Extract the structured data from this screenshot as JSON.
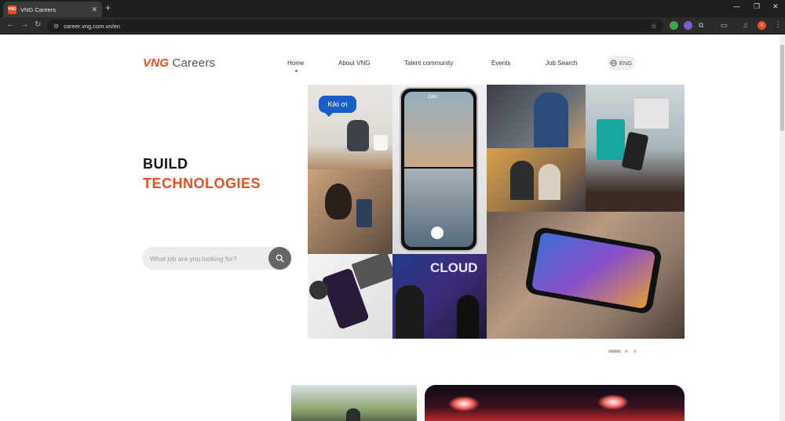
{
  "browser": {
    "tab_title": "VNG Careers",
    "favicon_text": "VNG",
    "url": "career.vng.com.vn/en",
    "profile_initial": "V"
  },
  "header": {
    "logo_brand": "VNG",
    "logo_text": "Careers",
    "nav": [
      "Home",
      "About VNG",
      "Talent community",
      "Events",
      "Job Search"
    ],
    "active_nav": "Home",
    "language": "ENG"
  },
  "hero": {
    "line1": "BUILD",
    "line2": "TECHNOLOGIES",
    "search_placeholder": "What job are you looking for?",
    "bubble_text": "Kiki ơi",
    "banner_text": "CLOUD",
    "app_label": "Zalo",
    "slides_count": 3,
    "active_slide": 1
  },
  "colors": {
    "brand": "#e8501d",
    "chrome_bg": "#1f1f1f"
  }
}
